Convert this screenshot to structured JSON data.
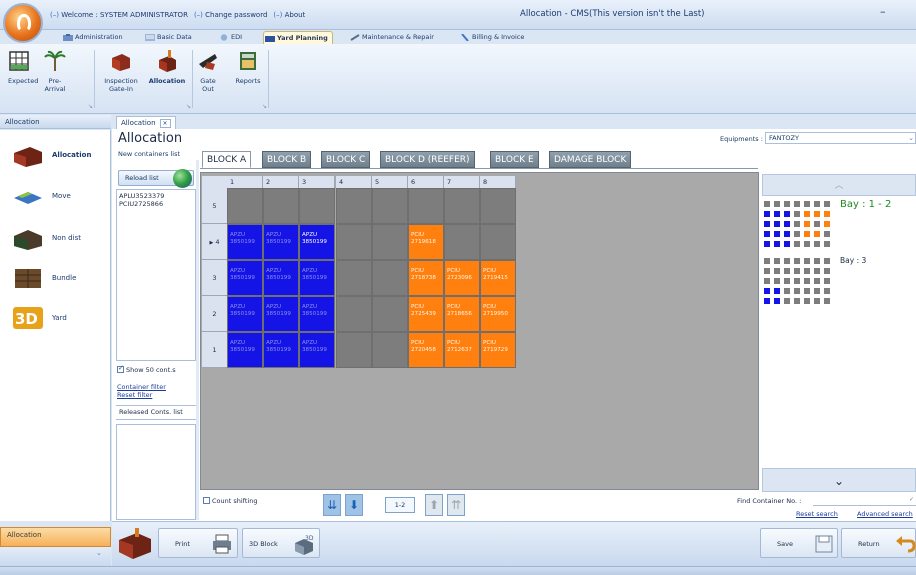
{
  "window": {
    "top_menu": [
      "Welcome : SYSTEM ADMINISTRATOR",
      "Change password",
      "About"
    ],
    "title": "Allocation - CMS(This version isn't the Last)",
    "minimize": "–"
  },
  "ribbon_tabs": [
    "Administration",
    "Basic Data",
    "EDI",
    "Yard Planning",
    "Maintenance & Repair",
    "Billing & Invoice"
  ],
  "ribbon_active_tab": "Yard Planning",
  "ribbon_buttons": [
    "Expected",
    "Pre-Arrival",
    "Inspection Gate-In",
    "Allocation",
    "Gate Out",
    "Reports"
  ],
  "ribbon_active_button": "Allocation",
  "left_panel": {
    "header": "Allocation",
    "items": [
      "Allocation",
      "Move",
      "Non dist",
      "Bundle",
      "Yard"
    ],
    "active": "Allocation",
    "footer": "Allocation"
  },
  "doc_tab": {
    "label": "Allocation",
    "close": "×"
  },
  "page": {
    "title": "Allocation",
    "new_containers_label": "New containers list",
    "reload_button": "Reload list",
    "containers": [
      "APLU3523379",
      "PCIU2725866"
    ],
    "show_50": "Show 50 cont.s",
    "show_50_checked": true,
    "container_filter": "Container filter",
    "reset_filter": "Reset filter",
    "released_label": "Released Conts. list",
    "equipments_label": "Equipments :",
    "equipments_value": "FANTOZY"
  },
  "block_tabs": [
    "BLOCK A",
    "BLOCK B",
    "BLOCK C",
    "BLOCK D (REEFER)",
    "BLOCK E",
    "DAMAGE BLOCK"
  ],
  "block_active": "BLOCK A",
  "grid": {
    "columns": [
      "1",
      "2",
      "3",
      "4",
      "5",
      "6",
      "7",
      "8"
    ],
    "current_row_marker": "▶",
    "rows": [
      {
        "label": "5",
        "cells": [
          {
            "c": "empty"
          },
          {
            "c": "empty"
          },
          {
            "c": "empty"
          },
          {
            "c": "empty"
          },
          {
            "c": "empty"
          },
          {
            "c": "empty"
          },
          {
            "c": "empty"
          },
          {
            "c": "empty"
          }
        ]
      },
      {
        "label": "4",
        "current": true,
        "cells": [
          {
            "c": "blue",
            "t1": "APZU",
            "t2": "3850199"
          },
          {
            "c": "blue",
            "t1": "APZU",
            "t2": "3850199"
          },
          {
            "c": "blue",
            "t1": "APZU",
            "t2": "3850199",
            "strong": true
          },
          {
            "c": "empty"
          },
          {
            "c": "empty"
          },
          {
            "c": "orange",
            "t1": "PCIU",
            "t2": "2719618"
          },
          {
            "c": "empty"
          },
          {
            "c": "empty"
          }
        ]
      },
      {
        "label": "3",
        "cells": [
          {
            "c": "blue",
            "t1": "APZU",
            "t2": "3850199"
          },
          {
            "c": "blue",
            "t1": "APZU",
            "t2": "3850199"
          },
          {
            "c": "blue",
            "t1": "APZU",
            "t2": "3850199"
          },
          {
            "c": "empty"
          },
          {
            "c": "empty"
          },
          {
            "c": "orange",
            "t1": "PCIU",
            "t2": "2718738"
          },
          {
            "c": "orange",
            "t1": "PCIU",
            "t2": "2723096"
          },
          {
            "c": "orange",
            "t1": "PCIU",
            "t2": "2719415"
          }
        ]
      },
      {
        "label": "2",
        "cells": [
          {
            "c": "blue",
            "t1": "APZU",
            "t2": "3850199"
          },
          {
            "c": "blue",
            "t1": "APZU",
            "t2": "3850199"
          },
          {
            "c": "blue",
            "t1": "APZU",
            "t2": "3850199"
          },
          {
            "c": "empty"
          },
          {
            "c": "empty"
          },
          {
            "c": "orange",
            "t1": "PCIU",
            "t2": "2725439"
          },
          {
            "c": "orange",
            "t1": "PCIU",
            "t2": "2718656"
          },
          {
            "c": "orange",
            "t1": "PCIU",
            "t2": "2719950"
          }
        ]
      },
      {
        "label": "1",
        "cells": [
          {
            "c": "blue",
            "t1": "APZU",
            "t2": "3850199"
          },
          {
            "c": "blue",
            "t1": "APZU",
            "t2": "3850199"
          },
          {
            "c": "blue",
            "t1": "APZU",
            "t2": "3850199"
          },
          {
            "c": "empty"
          },
          {
            "c": "empty"
          },
          {
            "c": "orange",
            "t1": "PCIU",
            "t2": "2720458"
          },
          {
            "c": "orange",
            "t1": "PCIU",
            "t2": "2712637"
          },
          {
            "c": "orange",
            "t1": "PCIU",
            "t2": "2719729"
          }
        ]
      }
    ]
  },
  "bays": [
    {
      "label": "Bay : 1 - 2",
      "highlight": true,
      "cells": [
        "ggggggg",
        "bbbgooo",
        "bbbgogo",
        "bbbgoog",
        "bbbgggg"
      ]
    },
    {
      "label": "Bay : 3",
      "cells": [
        "ggggggg",
        "ggggggg",
        "ggggggg",
        "bbggggg",
        "bbggggg"
      ]
    }
  ],
  "bay_panel": {
    "up": "︿",
    "down": "⌄"
  },
  "bottom": {
    "count_shifting": "Count shifting",
    "page_indicator": "1-2",
    "find_label": "Find Container No. :",
    "find_value": "",
    "find_check": "✓",
    "reset_search": "Reset search",
    "advanced_search": "Advanced search"
  },
  "footer_buttons": [
    "Print",
    "3D Block",
    "Save",
    "Return"
  ],
  "colors": {
    "blue": "#1414e6",
    "orange": "#ff7f0f",
    "empty": "#7d7d7d",
    "bay_label": "#1f8a1f"
  }
}
